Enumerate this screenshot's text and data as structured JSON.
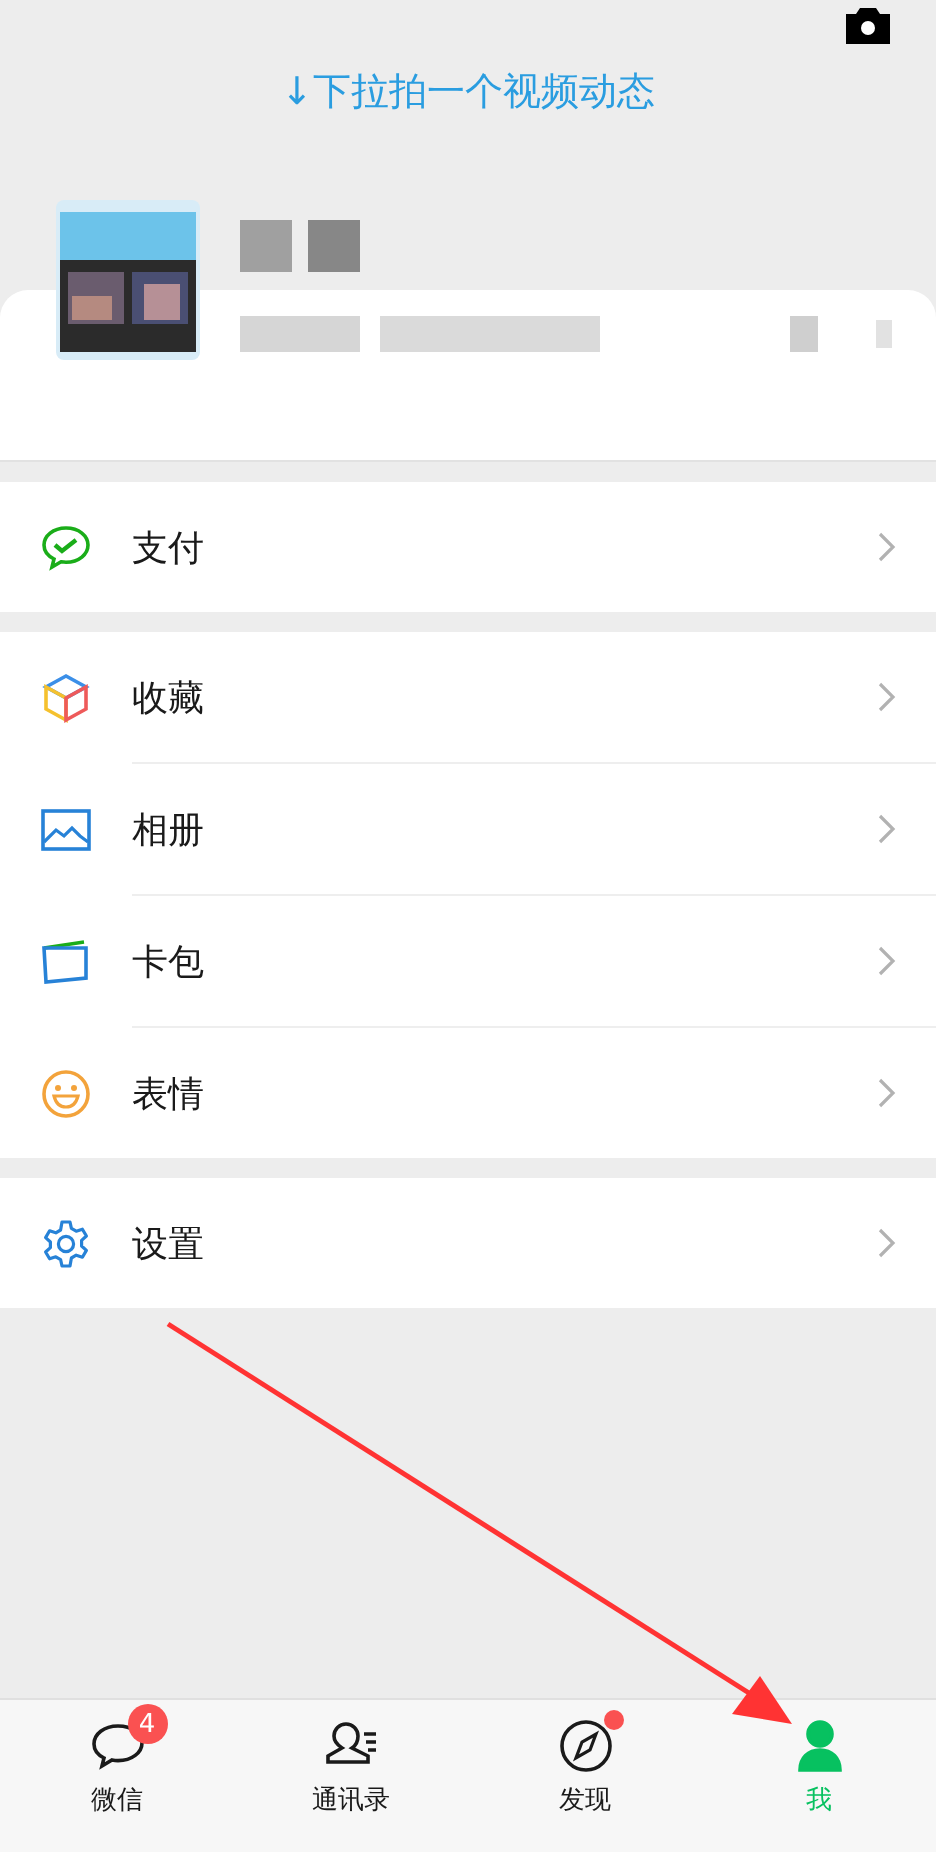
{
  "hint": "↓下拉拍一个视频动态",
  "menu_groups": [
    {
      "items": [
        {
          "kind": "pay",
          "label": "支付"
        }
      ]
    },
    {
      "items": [
        {
          "kind": "favorites",
          "label": "收藏"
        },
        {
          "kind": "album",
          "label": "相册"
        },
        {
          "kind": "cards",
          "label": "卡包"
        },
        {
          "kind": "stickers",
          "label": "表情"
        }
      ]
    },
    {
      "items": [
        {
          "kind": "settings",
          "label": "设置"
        }
      ]
    }
  ],
  "tabs": [
    {
      "kind": "chats",
      "label": "微信",
      "badge": "4",
      "dot": false,
      "selected": false
    },
    {
      "kind": "contacts",
      "label": "通讯录",
      "dot": false,
      "selected": false
    },
    {
      "kind": "discover",
      "label": "发现",
      "dot": true,
      "selected": false
    },
    {
      "kind": "me",
      "label": "我",
      "dot": false,
      "selected": true
    }
  ]
}
